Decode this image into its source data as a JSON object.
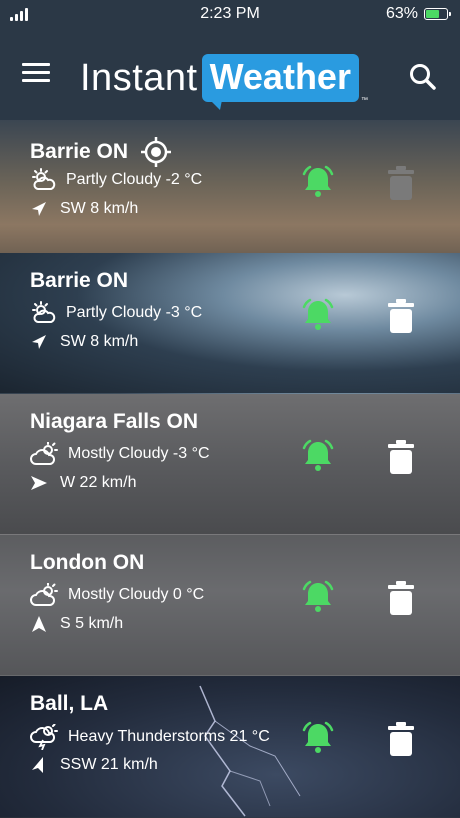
{
  "status_bar": {
    "time": "2:23 PM",
    "battery": "63%"
  },
  "header": {
    "logo_word1": "Instant",
    "logo_word2": "Weather",
    "trademark": "™"
  },
  "colors": {
    "accent": "#2a9be0",
    "alarm": "#4cd964",
    "header_bg": "#2b3846"
  },
  "locations": [
    {
      "city": "Barrie ON",
      "current_location": true,
      "condition_icon": "partly-cloudy-icon",
      "condition": "Partly Cloudy -2 °C",
      "wind": "SW 8 km/h",
      "wind_direction": "SW",
      "alarm_on": true,
      "delete_enabled": false
    },
    {
      "city": "Barrie ON",
      "current_location": false,
      "condition_icon": "partly-cloudy-icon",
      "condition": "Partly Cloudy -3 °C",
      "wind": "SW 8 km/h",
      "wind_direction": "SW",
      "alarm_on": true,
      "delete_enabled": true
    },
    {
      "city": "Niagara Falls ON",
      "current_location": false,
      "condition_icon": "mostly-cloudy-icon",
      "condition": "Mostly Cloudy -3 °C",
      "wind": "W 22 km/h",
      "wind_direction": "W",
      "alarm_on": true,
      "delete_enabled": true
    },
    {
      "city": "London ON",
      "current_location": false,
      "condition_icon": "mostly-cloudy-icon",
      "condition": "Mostly Cloudy 0 °C",
      "wind": "S 5 km/h",
      "wind_direction": "S",
      "alarm_on": true,
      "delete_enabled": true
    },
    {
      "city": "Ball, LA",
      "current_location": false,
      "condition_icon": "thunderstorm-icon",
      "condition": "Heavy Thunderstorms 21 °C",
      "wind": "SSW 21 km/h",
      "wind_direction": "SSW",
      "alarm_on": true,
      "delete_enabled": true
    }
  ]
}
